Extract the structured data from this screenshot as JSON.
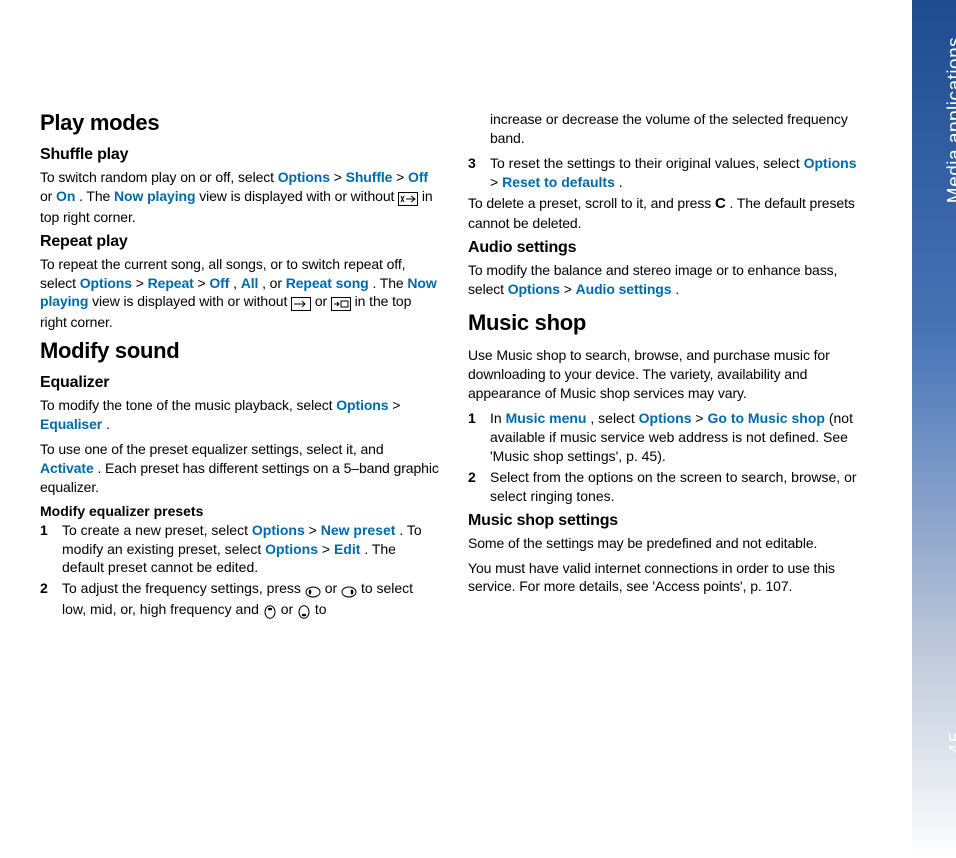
{
  "sidebar": {
    "section": "Media applications",
    "page": "45"
  },
  "col1": {
    "h_playmodes": "Play modes",
    "h_shuffle": "Shuffle play",
    "shuffle_a": "To switch random play on or off, select ",
    "link_options": "Options",
    "gt": " > ",
    "link_shuffle": "Shuffle",
    "link_off": "Off",
    "or_sp": " or ",
    "link_on": "On",
    "shuffle_b": ". The ",
    "link_nowplaying": "Now playing",
    "shuffle_c": " view is displayed with or without ",
    "shuffle_d": " in top right corner.",
    "h_repeat": "Repeat play",
    "repeat_a": "To repeat the current song, all songs, or to switch repeat off, select ",
    "link_repeat": "Repeat",
    "link_all": "All",
    "comma_sp": ", ",
    "or_comma": ", or ",
    "link_repeatsong": "Repeat song",
    "repeat_b": ". The ",
    "repeat_c": " view is displayed with or without ",
    "repeat_d": " in the top right corner.",
    "h_modify": "Modify sound",
    "h_eq": "Equalizer",
    "eq_a": "To modify the tone of the music playback, select ",
    "link_equaliser": "Equaliser",
    "period": ".",
    "eq_b1": "To use one of the preset equalizer settings, select it, and ",
    "link_activate": "Activate",
    "eq_b2": ". Each preset has different settings on a 5–band graphic equalizer.",
    "h_presets": "Modify equalizer presets",
    "li1_a": "To create a new preset, select ",
    "link_newpreset": "New preset",
    "li1_b": ". To modify an existing preset, select ",
    "link_edit": "Edit",
    "li1_c": ". The default preset cannot be edited.",
    "li2_a": "To adjust the frequency settings, press ",
    "li2_b": " to select low, mid, or, high frequency and ",
    "li2_c": " to",
    "n1": "1",
    "n2": "2"
  },
  "col2": {
    "cont_a": "increase or decrease the volume of the selected frequency band.",
    "n3": "3",
    "li3_a": "To reset the settings to their original values, select ",
    "link_options": "Options",
    "gt": " > ",
    "link_reset": "Reset to defaults",
    "period": ".",
    "delpreset_a": "To delete a preset, scroll to it, and press ",
    "key_c": "C",
    "delpreset_b": ". The default presets cannot be deleted.",
    "h_audio": "Audio settings",
    "audio_a": "To modify the balance and stereo image or to enhance bass, select ",
    "link_audiosettings": "Audio settings",
    "h_musicshop": "Music shop",
    "shop_intro": "Use Music shop to search, browse, and purchase music for downloading to your device. The variety, availability and appearance of Music shop services may vary.",
    "n1": "1",
    "li1_a": "In ",
    "link_musicmenu": "Music menu",
    "li1_b": ", select ",
    "link_gotoshop": "Go to Music shop",
    "li1_c": " (not available if music service web address is not defined. See 'Music shop settings', p. 45).",
    "n2": "2",
    "li2": "Select from the options on the screen to search, browse, or select ringing tones.",
    "h_shopsettings": "Music shop settings",
    "settings_a": "Some of the settings may be predefined and not editable.",
    "settings_b": "You must have valid internet connections in order to use this service. For more details, see 'Access points', p. 107."
  }
}
